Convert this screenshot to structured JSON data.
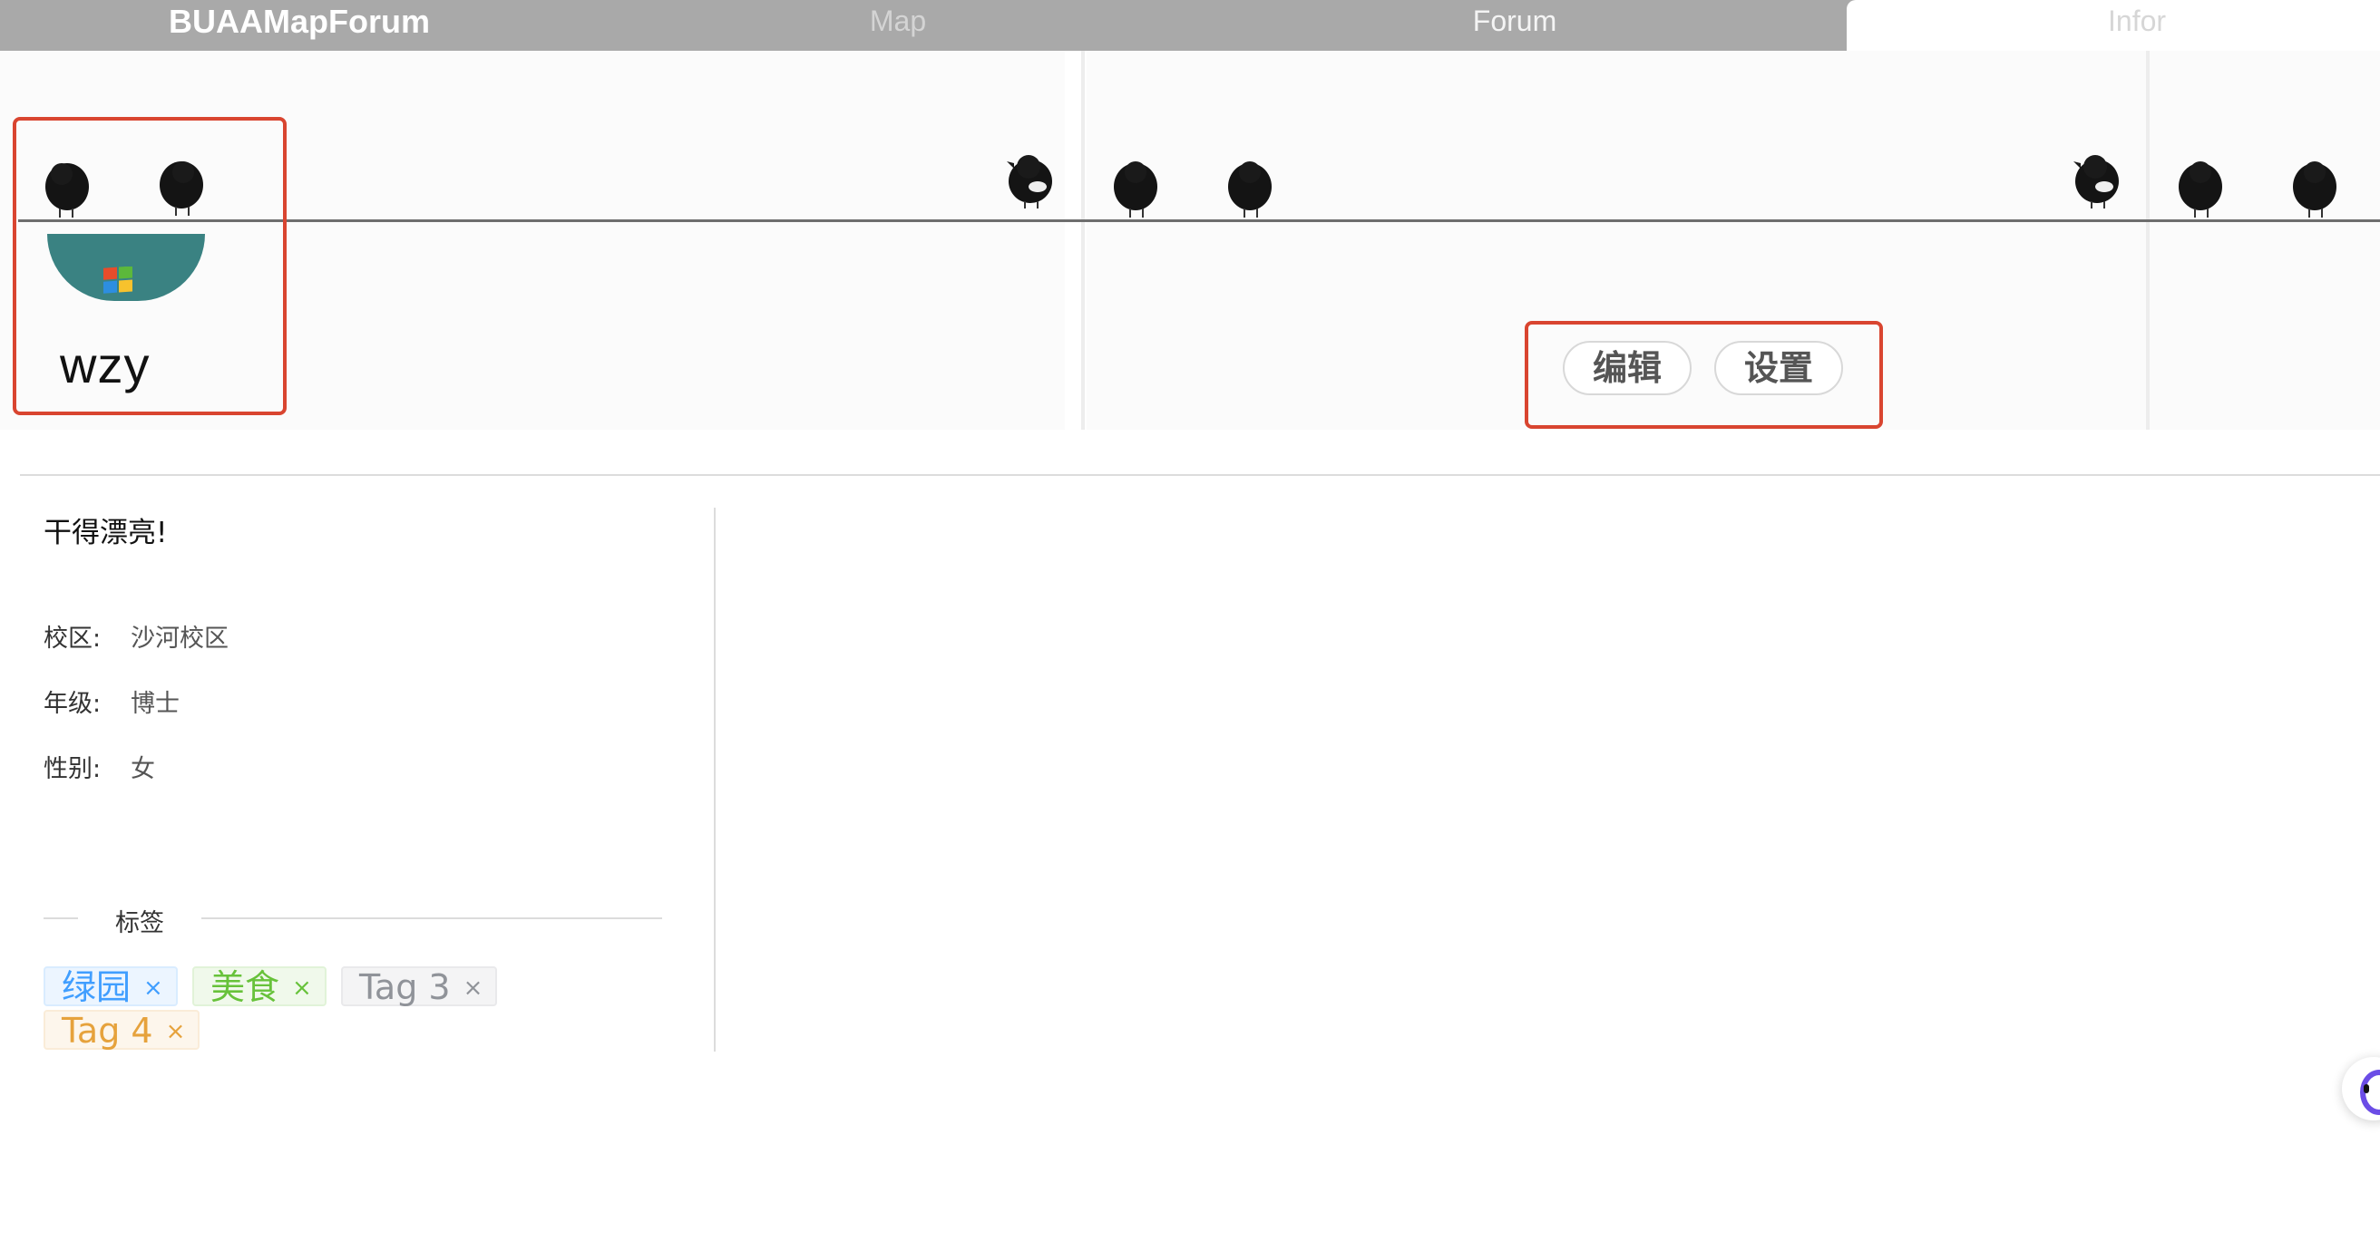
{
  "nav": {
    "brand": "BUAAMapForum",
    "items": [
      {
        "label": "Map"
      },
      {
        "label": "Forum"
      },
      {
        "label": "Infor"
      }
    ]
  },
  "profile": {
    "username": "wzy",
    "avatar_icon": "windows-logo-icon"
  },
  "actions": {
    "edit_label": "编辑",
    "settings_label": "设置"
  },
  "bio": "干得漂亮!",
  "info": [
    {
      "key": "校区:",
      "value": "沙河校区"
    },
    {
      "key": "年级:",
      "value": "博士"
    },
    {
      "key": "性别:",
      "value": "女"
    }
  ],
  "tags_title": "标签",
  "tags": [
    {
      "label": "绿园",
      "color": "#409eff"
    },
    {
      "label": "美食",
      "color": "#67c23a"
    },
    {
      "label": "Tag 3",
      "color": "#909399"
    },
    {
      "label": "Tag 4",
      "color": "#e6a23c"
    }
  ],
  "tag_close_glyph": "×",
  "colors": {
    "nav_bg": "#a9a9a9",
    "highlight": "#d94530",
    "avatar": "#3a8282"
  }
}
